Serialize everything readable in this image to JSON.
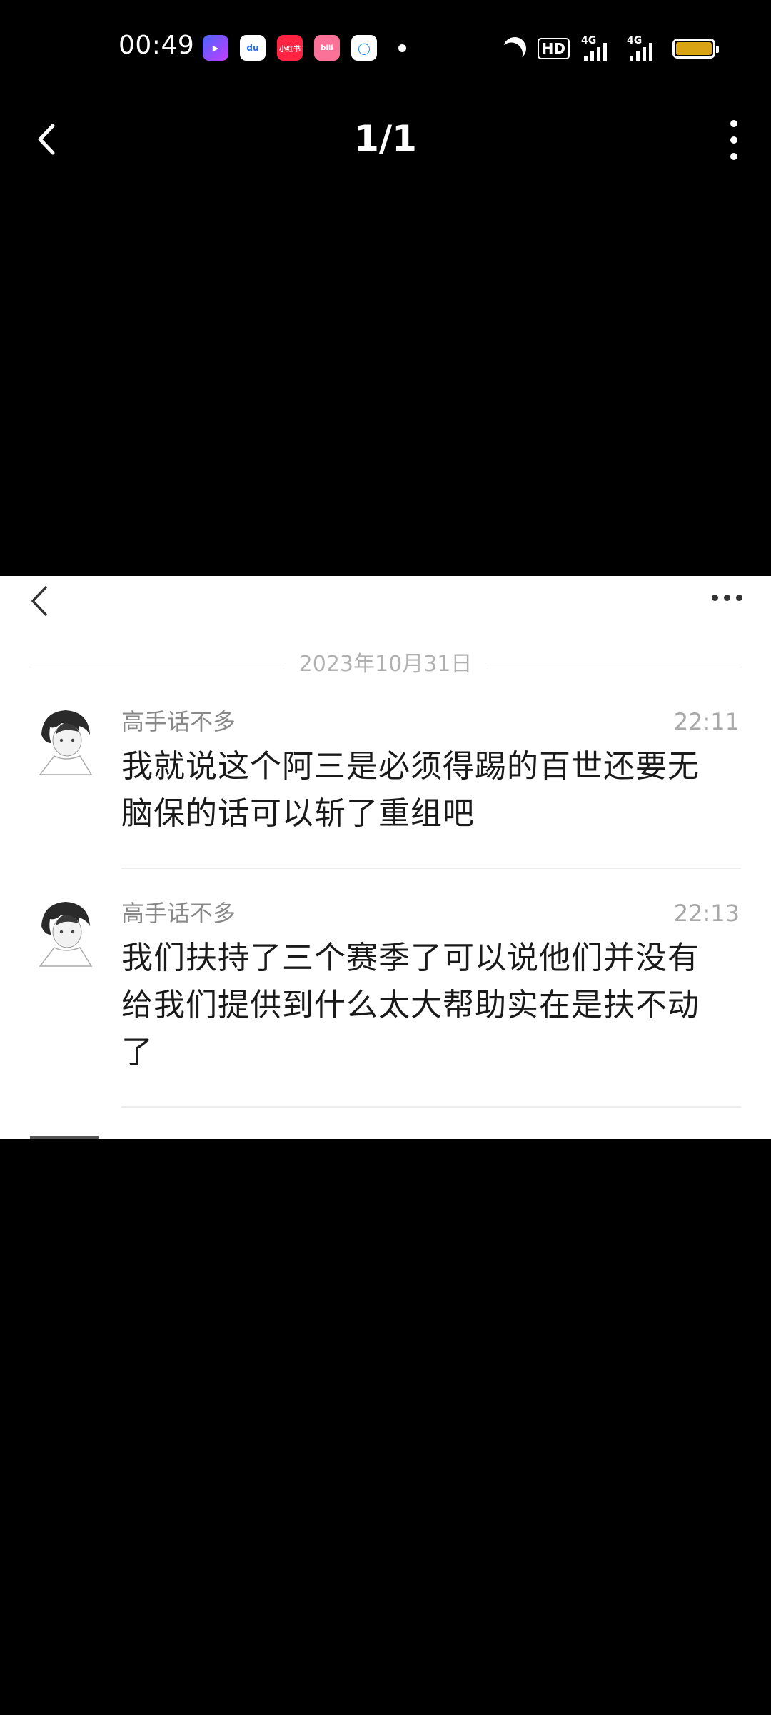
{
  "status_bar": {
    "time": "00:49",
    "apps": [
      {
        "name": "video-app-icon",
        "glyph": "▶"
      },
      {
        "name": "baidu-app-icon",
        "glyph": "du"
      },
      {
        "name": "xiaohongshu-app-icon",
        "glyph": "小红书"
      },
      {
        "name": "bilibili-app-icon",
        "glyph": "bili"
      },
      {
        "name": "qq-browser-app-icon",
        "glyph": "◯"
      }
    ],
    "hd_label": "HD",
    "signal_1_label": "4G",
    "signal_2_label": "4G",
    "battery_color": "#d9a414"
  },
  "viewer": {
    "page_counter": "1/1"
  },
  "chat": {
    "date": "2023年10月31日",
    "messages": [
      {
        "sender": "高手话不多",
        "time": "22:11",
        "text": "我就说这个阿三是必须得踢的百世还要无脑保的话可以斩了重组吧"
      },
      {
        "sender": "高手话不多",
        "time": "22:13",
        "text": "我们扶持了三个赛季了可以说他们并没有给我们提供到什么太大帮助实在是扶不动了"
      }
    ]
  }
}
